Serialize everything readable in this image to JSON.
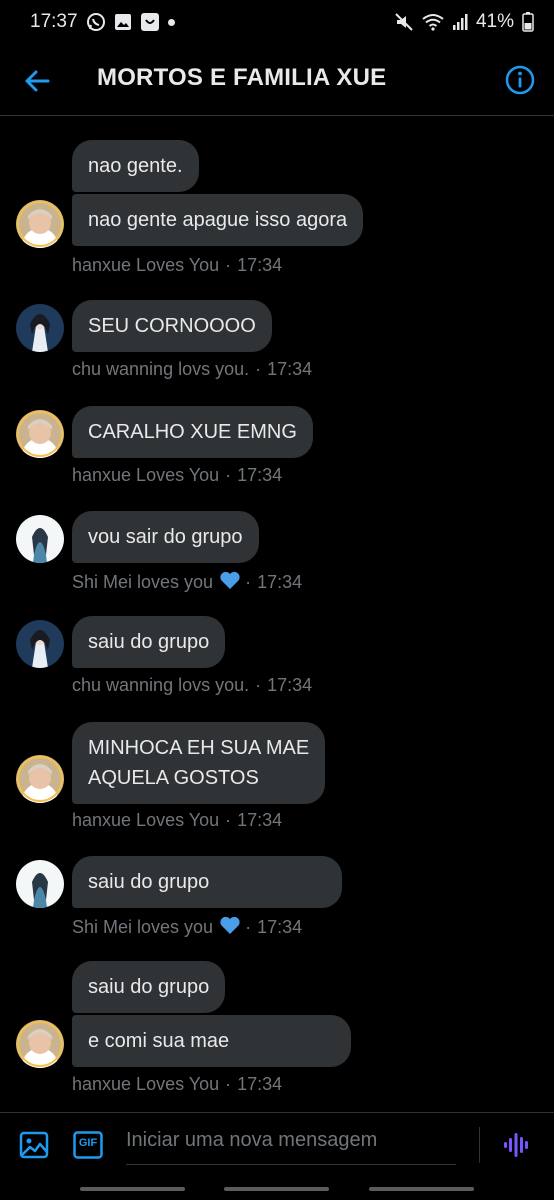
{
  "status_bar": {
    "time": "17:37",
    "battery": "41%",
    "icons": [
      "whatsapp-icon",
      "gallery-icon",
      "app-icon",
      "dot-icon",
      "mute-icon",
      "wifi-icon",
      "signal-icon",
      "battery-icon"
    ]
  },
  "header": {
    "title": "MORTOS E FAMILIA XUE",
    "back_icon": "arrow-left-icon",
    "info_icon": "info-icon",
    "accent_color": "#1d9bf0"
  },
  "messages": [
    {
      "sender": "hanxue",
      "bubbles": [
        "nao gente.",
        "nao gente apague isso agora"
      ],
      "name": "hanxue Loves You",
      "time": "17:34"
    },
    {
      "sender": "chu",
      "bubbles": [
        "SEU CORNOOOO"
      ],
      "name": "chu wanning lovs you.",
      "time": "17:34"
    },
    {
      "sender": "hanxue",
      "bubbles": [
        "CARALHO XUE EMNG"
      ],
      "name": "hanxue Loves You",
      "time": "17:34"
    },
    {
      "sender": "shimei",
      "bubbles": [
        "vou sair do grupo"
      ],
      "name": "Shi Mei loves you",
      "heart": true,
      "time": "17:34"
    },
    {
      "sender": "chu",
      "bubbles": [
        "saiu do grupo"
      ],
      "name": "chu wanning lovs you.",
      "time": "17:34"
    },
    {
      "sender": "hanxue",
      "bubbles": [
        "MINHOCA EH SUA MAE\nAQUELA GOSTOS"
      ],
      "name": "hanxue Loves You",
      "time": "17:34"
    },
    {
      "sender": "shimei",
      "bubbles": [
        "saiu do grupo"
      ],
      "name": "Shi Mei loves you",
      "heart": true,
      "time": "17:34"
    },
    {
      "sender": "hanxue",
      "bubbles": [
        "saiu do grupo",
        "e comi sua mae"
      ],
      "name": "hanxue Loves You",
      "time": "17:34"
    }
  ],
  "meta_separator": "·",
  "heart_color": "#4a9ee8",
  "composer": {
    "placeholder": "Iniciar uma nova mensagem",
    "image_icon": "image-icon",
    "gif_label": "GIF",
    "voice_icon": "voice-wave-icon",
    "voice_color": "#7856ff"
  }
}
